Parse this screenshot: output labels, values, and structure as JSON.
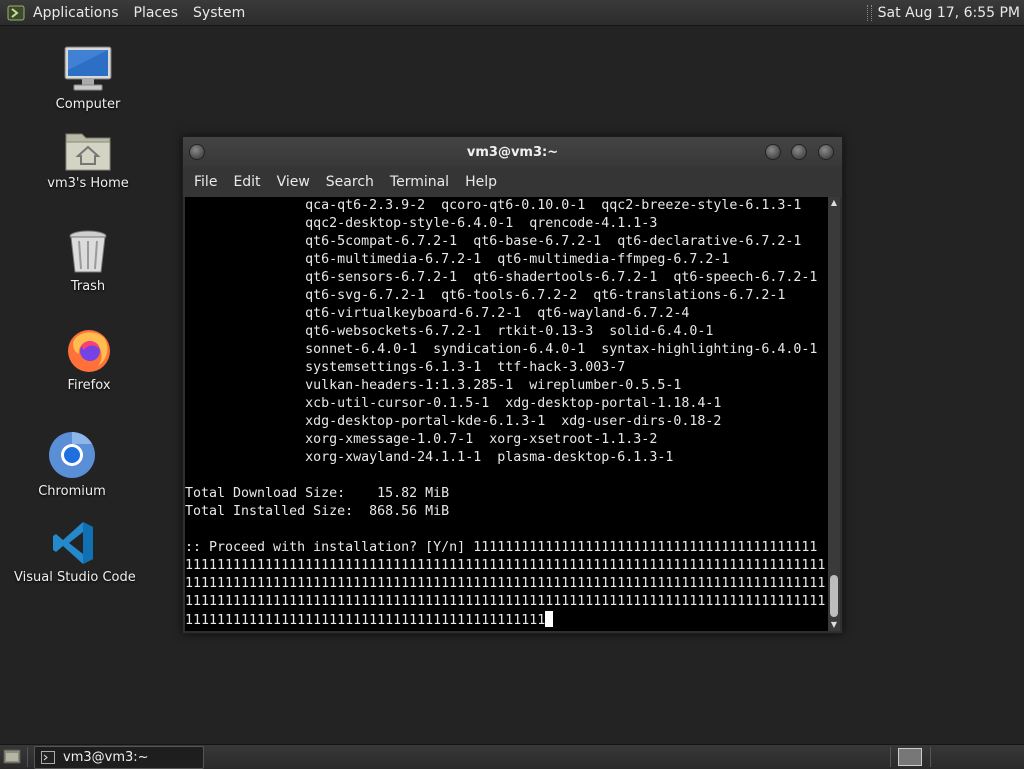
{
  "top_panel": {
    "menus": [
      "Applications",
      "Places",
      "System"
    ],
    "clock": "Sat Aug 17,  6:55 PM"
  },
  "desktop": {
    "icons": [
      {
        "label": "Computer",
        "icon": "computer-icon"
      },
      {
        "label": "vm3's Home",
        "icon": "home-folder-icon"
      },
      {
        "label": "Trash",
        "icon": "trash-icon"
      },
      {
        "label": "Firefox",
        "icon": "firefox-icon"
      },
      {
        "label": "Chromium",
        "icon": "chromium-icon"
      },
      {
        "label": "Visual Studio Code",
        "icon": "vscode-icon"
      }
    ]
  },
  "window": {
    "title": "vm3@vm3:~",
    "menu": [
      "File",
      "Edit",
      "View",
      "Search",
      "Terminal",
      "Help"
    ],
    "terminal_lines": [
      "               qca-qt6-2.3.9-2  qcoro-qt6-0.10.0-1  qqc2-breeze-style-6.1.3-1",
      "               qqc2-desktop-style-6.4.0-1  qrencode-4.1.1-3",
      "               qt6-5compat-6.7.2-1  qt6-base-6.7.2-1  qt6-declarative-6.7.2-1",
      "               qt6-multimedia-6.7.2-1  qt6-multimedia-ffmpeg-6.7.2-1",
      "               qt6-sensors-6.7.2-1  qt6-shadertools-6.7.2-1  qt6-speech-6.7.2-1",
      "               qt6-svg-6.7.2-1  qt6-tools-6.7.2-2  qt6-translations-6.7.2-1",
      "               qt6-virtualkeyboard-6.7.2-1  qt6-wayland-6.7.2-4",
      "               qt6-websockets-6.7.2-1  rtkit-0.13-3  solid-6.4.0-1",
      "               sonnet-6.4.0-1  syndication-6.4.0-1  syntax-highlighting-6.4.0-1",
      "               systemsettings-6.1.3-1  ttf-hack-3.003-7",
      "               vulkan-headers-1:1.3.285-1  wireplumber-0.5.5-1",
      "               xcb-util-cursor-0.1.5-1  xdg-desktop-portal-1.18.4-1",
      "               xdg-desktop-portal-kde-6.1.3-1  xdg-user-dirs-0.18-2",
      "               xorg-xmessage-1.0.7-1  xorg-xsetroot-1.1.3-2",
      "               xorg-xwayland-24.1.1-1  plasma-desktop-6.1.3-1",
      "",
      "Total Download Size:    15.82 MiB",
      "Total Installed Size:  868.56 MiB",
      "",
      ":: Proceed with installation? [Y/n] 1111111111111111111111111111111111111111111",
      "11111111111111111111111111111111111111111111111111111111111111111111111111111111",
      "11111111111111111111111111111111111111111111111111111111111111111111111111111111",
      "11111111111111111111111111111111111111111111111111111111111111111111111111111111",
      "111111111111111111111111111111111111111111111"
    ]
  },
  "taskbar": {
    "task_label": "vm3@vm3:~"
  }
}
